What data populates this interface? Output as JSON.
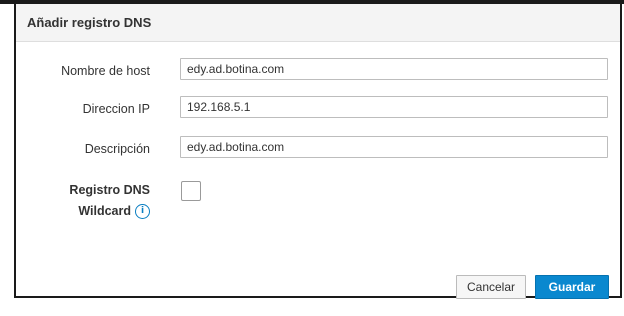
{
  "dialog": {
    "title": "Añadir registro DNS"
  },
  "form": {
    "hostname": {
      "label": "Nombre de host",
      "value": "edy.ad.botina.com"
    },
    "ip": {
      "label": "Direccion IP",
      "value": "192.168.5.1"
    },
    "description": {
      "label": "Descripción",
      "value": "edy.ad.botina.com"
    },
    "wildcard": {
      "label_line1": "Registro DNS",
      "label_line2": "Wildcard",
      "checked": false
    }
  },
  "buttons": {
    "cancel_label": "Cancelar",
    "save_label": "Guardar"
  },
  "colors": {
    "accent": "#0a88cf",
    "info": "#0a7ec2"
  },
  "icons": {
    "info": "info-circle-icon"
  }
}
